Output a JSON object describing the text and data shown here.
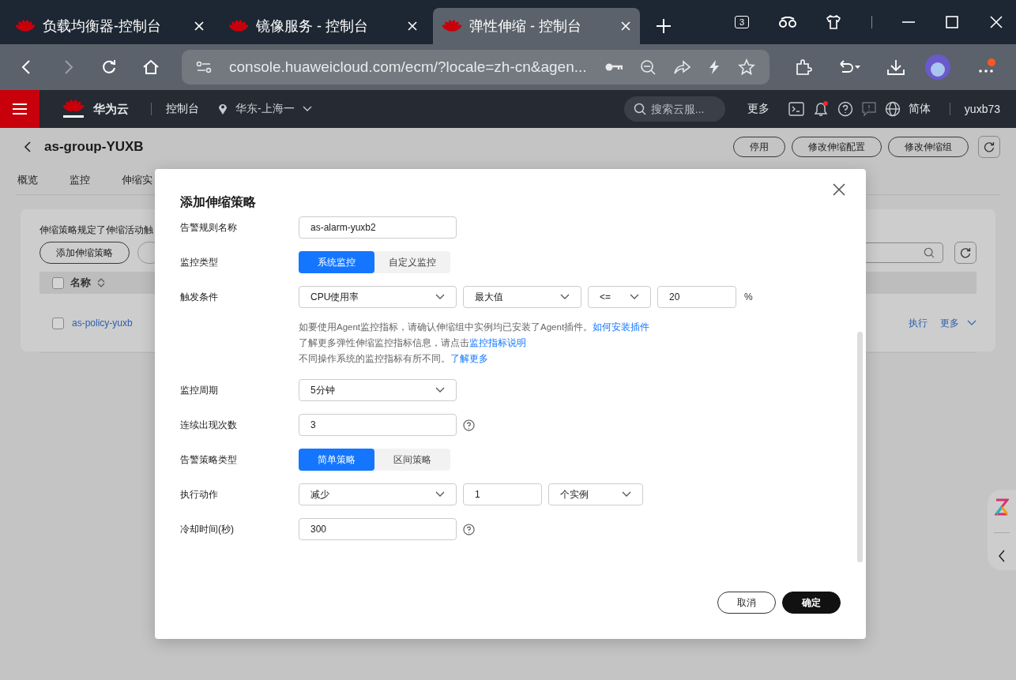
{
  "browser": {
    "tabs": [
      {
        "title": "负载均衡器-控制台",
        "selected": false
      },
      {
        "title": "镜像服务 - 控制台",
        "selected": false
      },
      {
        "title": "弹性伸缩 - 控制台",
        "selected": true
      }
    ],
    "tab_count": "3",
    "url": "console.huaweicloud.com/ecm/?locale=zh-cn&agen..."
  },
  "header": {
    "brand": "华为云",
    "console": "控制台",
    "region": "华东-上海一",
    "search_placeholder": "搜索云服...",
    "more": "更多",
    "language": "简体",
    "user": "yuxb73"
  },
  "page": {
    "title": "as-group-YUXB",
    "buttons": [
      "停用",
      "修改伸缩配置",
      "修改伸缩组"
    ],
    "nav": [
      {
        "label": "概览",
        "selected": false
      },
      {
        "label": "监控",
        "selected": false
      },
      {
        "label": "伸缩实",
        "selected": false
      }
    ],
    "description": "伸缩策略规定了伸缩活动触",
    "add_button": "添加伸缩策略",
    "column": "名称",
    "select_all": {
      "checked": false
    },
    "rows": [
      {
        "name": "as-policy-yuxb",
        "checked": false,
        "actions": [
          "执行",
          "更多"
        ]
      }
    ]
  },
  "dialog": {
    "title": "添加伸缩策略",
    "fields": [
      {
        "kind": "input",
        "label": "告警规则名称",
        "value": "as-alarm-yuxb2"
      },
      {
        "kind": "segmented",
        "label": "监控类型",
        "options": [
          {
            "label": "系统监控",
            "selected": true
          },
          {
            "label": "自定义监控",
            "selected": false
          }
        ]
      },
      {
        "kind": "condition",
        "label": "触发条件",
        "metric": "CPU使用率",
        "aggregation": "最大值",
        "operator": "<=",
        "threshold": "20",
        "unit": "%",
        "help": [
          [
            {
              "text": "如要使用Agent监控指标，请确认伸缩组中实例均已安装了Agent插件。"
            },
            {
              "link": "如何安装插件"
            }
          ],
          [
            {
              "text": "了解更多弹性伸缩监控指标信息，请点击"
            },
            {
              "link": "监控指标说明"
            }
          ],
          [
            {
              "text": "不同操作系统的监控指标有所不同。"
            },
            {
              "link": "了解更多"
            }
          ]
        ]
      },
      {
        "kind": "select",
        "label": "监控周期",
        "value": "5分钟"
      },
      {
        "kind": "input",
        "label": "连续出现次数",
        "value": "3",
        "help_icon": true
      },
      {
        "kind": "segmented",
        "label": "告警策略类型",
        "options": [
          {
            "label": "简单策略",
            "selected": true
          },
          {
            "label": "区间策略",
            "selected": false
          }
        ]
      },
      {
        "kind": "action",
        "label": "执行动作",
        "action": "减少",
        "count": "1",
        "unit": "个实例"
      },
      {
        "kind": "input",
        "label": "冷却时间(秒)",
        "value": "300",
        "help_icon": true
      }
    ],
    "cancel": "取消",
    "confirm": "确定"
  }
}
